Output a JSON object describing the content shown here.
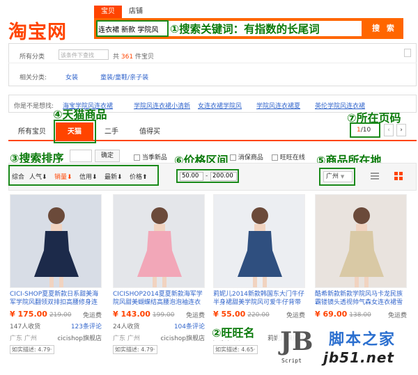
{
  "logo": "淘宝网",
  "top_tabs": [
    "宝贝",
    "店铺"
  ],
  "search": {
    "value": "连衣裙 新款 学院风",
    "button": "搜 索"
  },
  "filters": {
    "all_categories": "所有分类",
    "within_placeholder": "该条件下查找",
    "total_prefix": "共",
    "total_count": "361",
    "total_suffix": "件宝贝",
    "related_label": "相关分类:",
    "related": [
      "女装",
      "童装/童鞋/亲子装"
    ]
  },
  "suggest": {
    "label": "你是不是想找:",
    "items": [
      "海宝学院风连衣裙",
      "学院风连衣裙小清新",
      "女连衣裙学院风",
      "学院风连衣裙夏",
      "英伦学院风连衣裙"
    ]
  },
  "result_tabs": [
    "所有宝贝",
    "天猫",
    "二手",
    "值得买"
  ],
  "pager": {
    "current": "1",
    "total": "/10"
  },
  "toolbar": {
    "search_btn": "确定",
    "checks": [
      "当季新品",
      "消保商品",
      "旺旺在线"
    ],
    "sorts": [
      "综合",
      "人气",
      "销量",
      "信用",
      "最新",
      "价格"
    ],
    "price_from": "50.00",
    "price_dash": "-",
    "price_to": "200.00",
    "location": "广州"
  },
  "annotations": {
    "a1": "①搜索关键词：有指数的长尾词",
    "a2": "②旺旺名",
    "a3": "③搜索排序",
    "a4": "④天猫商品",
    "a5": "⑤商品所在地",
    "a6": "⑥价格区间",
    "a7": "⑦所在页码"
  },
  "products": [
    {
      "title": "CICI-SHOP夏夏新款日系甜美海军学院风翻领双排扣高腰修身连衣裙",
      "price": "¥ 175.00",
      "old": "219.00",
      "free": "免运费",
      "buyers": "147人收货",
      "comments": "123条评论",
      "shop": "cicishop旗舰店",
      "location": "广东 广州",
      "desc": "如实描述: 4.79·",
      "img_bg": "#d8dde6",
      "dress": "#1c2a4a"
    },
    {
      "title": "CICISHOP2014夏夏新款海军学院风甜美蝴蝶结高腰泡泡袖连衣裙15",
      "price": "¥ 143.00",
      "old": "199.00",
      "free": "免运费",
      "buyers": "24人收货",
      "comments": "104条评论",
      "shop": "cicishop旗舰店",
      "location": "广东 广州",
      "desc": "如实描述: 4.79·",
      "img_bg": "#e4e6ea",
      "dress": "#f2a7b8"
    },
    {
      "title": "莉妮儿2014新款韩国东大门牛仔半身裙甜美学院风可爱牛仔背带裙",
      "price": "¥ 55.00",
      "old": "220.00",
      "free": "免运费",
      "buyers": "",
      "comments": "",
      "shop": "莉妮儿旗舰店",
      "location": "广东 广州",
      "desc": "如实描述: 4.65·",
      "img_bg": "#eceef2",
      "dress": "#2f4f7f"
    },
    {
      "title": "酷希新款新款学院风马卡龙民族霸镂镜头透视帅气森女连衣裙雪纺连衣裙",
      "price": "¥ 69.00",
      "old": "138.00",
      "free": "免运费",
      "buyers": "",
      "comments": "",
      "shop": "",
      "location": "",
      "desc": "",
      "img_bg": "#e9e3de",
      "dress": "#d9c9a5"
    }
  ],
  "watermark": {
    "big": "脚本之家",
    "url": "jb51.net",
    "mark": "JB",
    "script": "Script"
  },
  "colors": {
    "accent": "#f40",
    "annotation": "#0a7a0a",
    "link": "#36c"
  }
}
